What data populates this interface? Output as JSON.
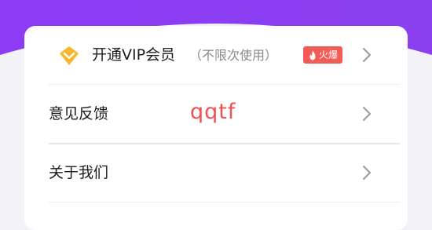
{
  "menu": {
    "vip": {
      "title": "开通VIP会员",
      "note": "（不限次使用）",
      "badge": "火爆",
      "icon": "diamond-icon"
    },
    "feedback": {
      "title": "意见反馈",
      "overlay": "qqtf"
    },
    "about": {
      "title": "关于我们"
    }
  },
  "colors": {
    "header_purple": "#8a3cf3",
    "badge_red": "#f25c56",
    "overlay_red": "#f25050",
    "vip_gold": "#f8b628"
  }
}
